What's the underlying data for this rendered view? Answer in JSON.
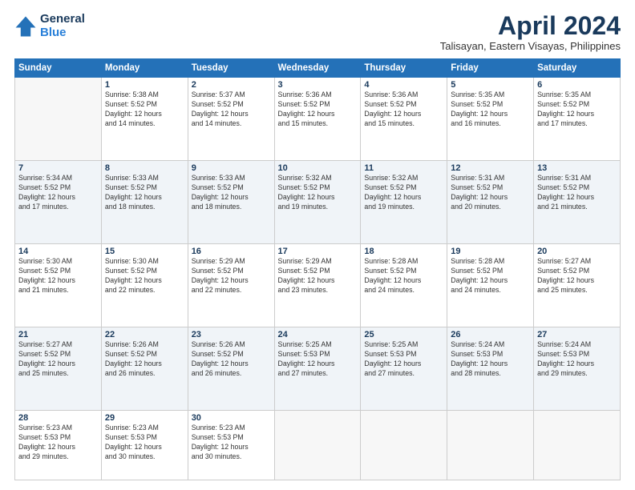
{
  "header": {
    "logo_line1": "General",
    "logo_line2": "Blue",
    "month": "April 2024",
    "location": "Talisayan, Eastern Visayas, Philippines"
  },
  "weekdays": [
    "Sunday",
    "Monday",
    "Tuesday",
    "Wednesday",
    "Thursday",
    "Friday",
    "Saturday"
  ],
  "weeks": [
    [
      {
        "day": "",
        "info": ""
      },
      {
        "day": "1",
        "info": "Sunrise: 5:38 AM\nSunset: 5:52 PM\nDaylight: 12 hours\nand 14 minutes."
      },
      {
        "day": "2",
        "info": "Sunrise: 5:37 AM\nSunset: 5:52 PM\nDaylight: 12 hours\nand 14 minutes."
      },
      {
        "day": "3",
        "info": "Sunrise: 5:36 AM\nSunset: 5:52 PM\nDaylight: 12 hours\nand 15 minutes."
      },
      {
        "day": "4",
        "info": "Sunrise: 5:36 AM\nSunset: 5:52 PM\nDaylight: 12 hours\nand 15 minutes."
      },
      {
        "day": "5",
        "info": "Sunrise: 5:35 AM\nSunset: 5:52 PM\nDaylight: 12 hours\nand 16 minutes."
      },
      {
        "day": "6",
        "info": "Sunrise: 5:35 AM\nSunset: 5:52 PM\nDaylight: 12 hours\nand 17 minutes."
      }
    ],
    [
      {
        "day": "7",
        "info": "Sunrise: 5:34 AM\nSunset: 5:52 PM\nDaylight: 12 hours\nand 17 minutes."
      },
      {
        "day": "8",
        "info": "Sunrise: 5:33 AM\nSunset: 5:52 PM\nDaylight: 12 hours\nand 18 minutes."
      },
      {
        "day": "9",
        "info": "Sunrise: 5:33 AM\nSunset: 5:52 PM\nDaylight: 12 hours\nand 18 minutes."
      },
      {
        "day": "10",
        "info": "Sunrise: 5:32 AM\nSunset: 5:52 PM\nDaylight: 12 hours\nand 19 minutes."
      },
      {
        "day": "11",
        "info": "Sunrise: 5:32 AM\nSunset: 5:52 PM\nDaylight: 12 hours\nand 19 minutes."
      },
      {
        "day": "12",
        "info": "Sunrise: 5:31 AM\nSunset: 5:52 PM\nDaylight: 12 hours\nand 20 minutes."
      },
      {
        "day": "13",
        "info": "Sunrise: 5:31 AM\nSunset: 5:52 PM\nDaylight: 12 hours\nand 21 minutes."
      }
    ],
    [
      {
        "day": "14",
        "info": "Sunrise: 5:30 AM\nSunset: 5:52 PM\nDaylight: 12 hours\nand 21 minutes."
      },
      {
        "day": "15",
        "info": "Sunrise: 5:30 AM\nSunset: 5:52 PM\nDaylight: 12 hours\nand 22 minutes."
      },
      {
        "day": "16",
        "info": "Sunrise: 5:29 AM\nSunset: 5:52 PM\nDaylight: 12 hours\nand 22 minutes."
      },
      {
        "day": "17",
        "info": "Sunrise: 5:29 AM\nSunset: 5:52 PM\nDaylight: 12 hours\nand 23 minutes."
      },
      {
        "day": "18",
        "info": "Sunrise: 5:28 AM\nSunset: 5:52 PM\nDaylight: 12 hours\nand 24 minutes."
      },
      {
        "day": "19",
        "info": "Sunrise: 5:28 AM\nSunset: 5:52 PM\nDaylight: 12 hours\nand 24 minutes."
      },
      {
        "day": "20",
        "info": "Sunrise: 5:27 AM\nSunset: 5:52 PM\nDaylight: 12 hours\nand 25 minutes."
      }
    ],
    [
      {
        "day": "21",
        "info": "Sunrise: 5:27 AM\nSunset: 5:52 PM\nDaylight: 12 hours\nand 25 minutes."
      },
      {
        "day": "22",
        "info": "Sunrise: 5:26 AM\nSunset: 5:52 PM\nDaylight: 12 hours\nand 26 minutes."
      },
      {
        "day": "23",
        "info": "Sunrise: 5:26 AM\nSunset: 5:52 PM\nDaylight: 12 hours\nand 26 minutes."
      },
      {
        "day": "24",
        "info": "Sunrise: 5:25 AM\nSunset: 5:53 PM\nDaylight: 12 hours\nand 27 minutes."
      },
      {
        "day": "25",
        "info": "Sunrise: 5:25 AM\nSunset: 5:53 PM\nDaylight: 12 hours\nand 27 minutes."
      },
      {
        "day": "26",
        "info": "Sunrise: 5:24 AM\nSunset: 5:53 PM\nDaylight: 12 hours\nand 28 minutes."
      },
      {
        "day": "27",
        "info": "Sunrise: 5:24 AM\nSunset: 5:53 PM\nDaylight: 12 hours\nand 29 minutes."
      }
    ],
    [
      {
        "day": "28",
        "info": "Sunrise: 5:23 AM\nSunset: 5:53 PM\nDaylight: 12 hours\nand 29 minutes."
      },
      {
        "day": "29",
        "info": "Sunrise: 5:23 AM\nSunset: 5:53 PM\nDaylight: 12 hours\nand 30 minutes."
      },
      {
        "day": "30",
        "info": "Sunrise: 5:23 AM\nSunset: 5:53 PM\nDaylight: 12 hours\nand 30 minutes."
      },
      {
        "day": "",
        "info": ""
      },
      {
        "day": "",
        "info": ""
      },
      {
        "day": "",
        "info": ""
      },
      {
        "day": "",
        "info": ""
      }
    ]
  ]
}
